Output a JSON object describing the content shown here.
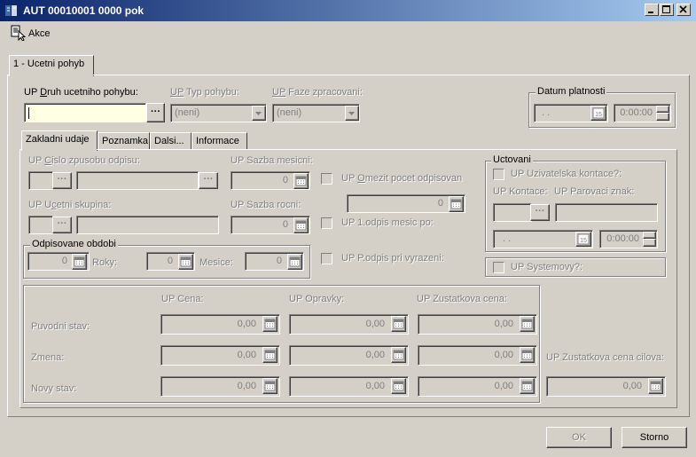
{
  "window": {
    "title": "AUT 00010001 0000 pok"
  },
  "menu": {
    "akce": "Akce"
  },
  "tabs_main": {
    "tab1": "1 - Ucetni pohyb"
  },
  "header": {
    "druh_label_prefix": "UP ",
    "druh_label_u": "D",
    "druh_label_rest": "ruh ucetniho pohybu:",
    "typ_label_prefix": "UP",
    "typ_label_rest": " Typ pohybu:",
    "faze_label_prefix": "UP",
    "faze_label_rest": " Faze zpracovani:",
    "typ_value": "(neni)",
    "faze_value": "(neni)",
    "dots": "···"
  },
  "datum": {
    "label": "Datum platnosti",
    "date_value": ". .",
    "time_value": "0:00:00",
    "cal": "15"
  },
  "subtabs": {
    "t1": "Zakladni udaje",
    "t2": "Poznamka",
    "t3": "Dalsi...",
    "t4": "Informace"
  },
  "zakladni": {
    "cislo_prefix": "UP ",
    "cislo_u": "C",
    "cislo_rest": "islo zpusobu odpisu:",
    "sazba_mes": "UP Sazba mesicni:",
    "sazba_mes_val": "0",
    "ucetni_prefix": "UP U",
    "ucetni_u": "c",
    "ucetni_rest": "etni skupina:",
    "sazba_roc": "UP Sazba rocni:",
    "sazba_roc_val": "0",
    "omezit_prefix": "UP ",
    "omezit_u": "O",
    "omezit_rest": "mezit pocet odpisovan",
    "omezit_val": "0",
    "odpis1": "UP 1.odpis mesic po:",
    "podpis": "UP P.odpis pri vyrazeni:",
    "obdobi_label": "Odpisovane obdobi",
    "obdobi_val1": "0",
    "roky": "Roky:",
    "obdobi_val2": "0",
    "mesice": "Mesice:",
    "obdobi_val3": "0"
  },
  "uctovani": {
    "label": "Uctovani",
    "uziv": "UP Uzivatelska kontace?:",
    "kontace": "UP Kontace:",
    "parovaci": "UP Parovaci znak:",
    "date_value": ". .",
    "time_value": "0:00:00",
    "cal": "15",
    "systemovy": "UP Systemovy?:"
  },
  "values": {
    "cena": "UP Cena:",
    "opravky": "UP Opravky:",
    "zustatkova": "UP Zustatkova cena:",
    "puvodni": "Puvodni stav:",
    "zmena": "Zmena:",
    "novy": "Novy stav:",
    "cilova": "UP Zustatkova cena cilova:",
    "v": "0,00"
  },
  "buttons": {
    "ok": "OK",
    "storno": "Storno"
  }
}
